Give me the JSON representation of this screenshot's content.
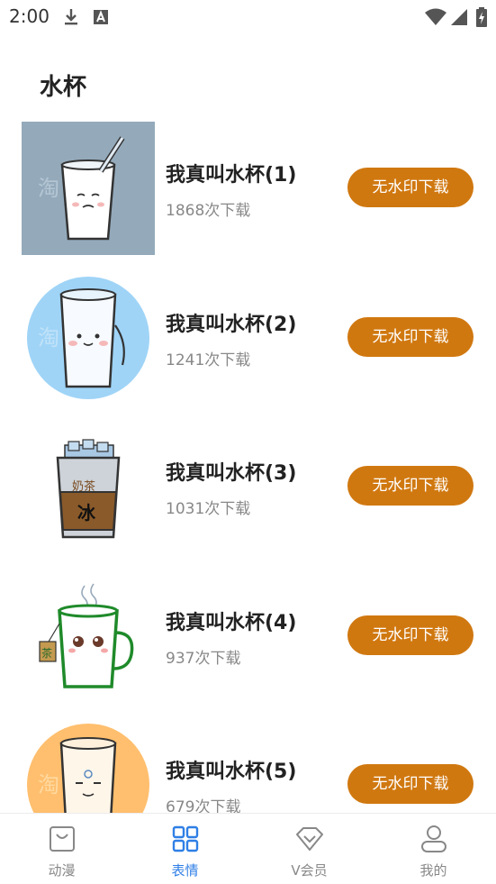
{
  "status_bar": {
    "time": "2:00",
    "icons": [
      "download-icon",
      "keyboard-a-icon",
      "wifi-icon",
      "signal-icon",
      "battery-icon"
    ]
  },
  "page": {
    "title": "水杯"
  },
  "items": [
    {
      "title": "我真叫水杯(1)",
      "downloads": "1868次下载",
      "button": "无水印下载",
      "watermark": "淘  漫"
    },
    {
      "title": "我真叫水杯(2)",
      "downloads": "1241次下载",
      "button": "无水印下载",
      "watermark": "淘  漫"
    },
    {
      "title": "我真叫水杯(3)",
      "downloads": "1031次下载",
      "button": "无水印下载",
      "cup_text": "冰",
      "band_text": "奶茶"
    },
    {
      "title": "我真叫水杯(4)",
      "downloads": "937次下载",
      "button": "无水印下载",
      "tag_text": "茶"
    },
    {
      "title": "我真叫水杯(5)",
      "downloads": "679次下载",
      "button": "无水印下载",
      "watermark": "淘  漫"
    }
  ],
  "bottom_nav": [
    {
      "label": "动漫",
      "icon": "bag-icon",
      "active": false
    },
    {
      "label": "表情",
      "icon": "grid-icon",
      "active": true
    },
    {
      "label": "V会员",
      "icon": "diamond-icon",
      "active": false
    },
    {
      "label": "我的",
      "icon": "person-icon",
      "active": false
    }
  ],
  "colors": {
    "accent": "#d07810",
    "active_tab": "#2f7fe6",
    "inactive_tab": "#888888"
  }
}
